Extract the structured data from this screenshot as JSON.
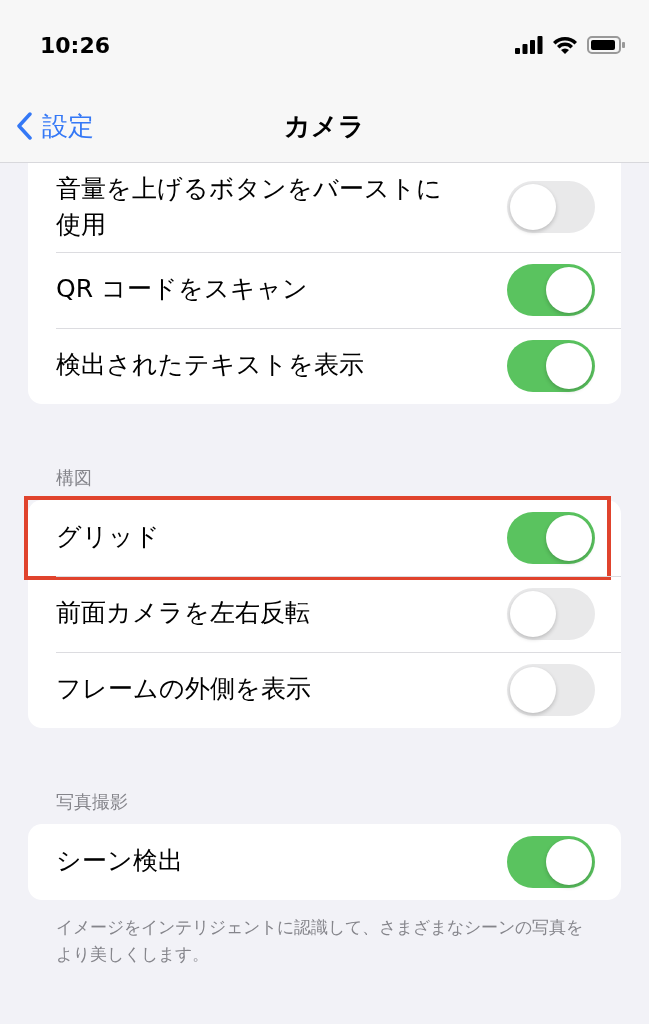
{
  "status_bar": {
    "time": "10:26"
  },
  "nav": {
    "back": "設定",
    "title": "カメラ"
  },
  "sections": [
    {
      "cut_top": true,
      "rows": [
        {
          "label": "音量を上げるボタンをバーストに使用",
          "on": false,
          "highlighted": false
        },
        {
          "label": "QR コードをスキャン",
          "on": true,
          "highlighted": false
        },
        {
          "label": "検出されたテキストを表示",
          "on": true,
          "highlighted": false
        }
      ]
    },
    {
      "header": "構図",
      "cut_top": false,
      "rows": [
        {
          "label": "グリッド",
          "on": true,
          "highlighted": true
        },
        {
          "label": "前面カメラを左右反転",
          "on": false,
          "highlighted": false
        },
        {
          "label": "フレームの外側を表示",
          "on": false,
          "highlighted": false
        }
      ]
    },
    {
      "header": "写真撮影",
      "cut_top": false,
      "rows": [
        {
          "label": "シーン検出",
          "on": true,
          "highlighted": false
        }
      ],
      "footer": "イメージをインテリジェントに認識して、さまざまなシーンの写真をより美しくします。"
    }
  ]
}
